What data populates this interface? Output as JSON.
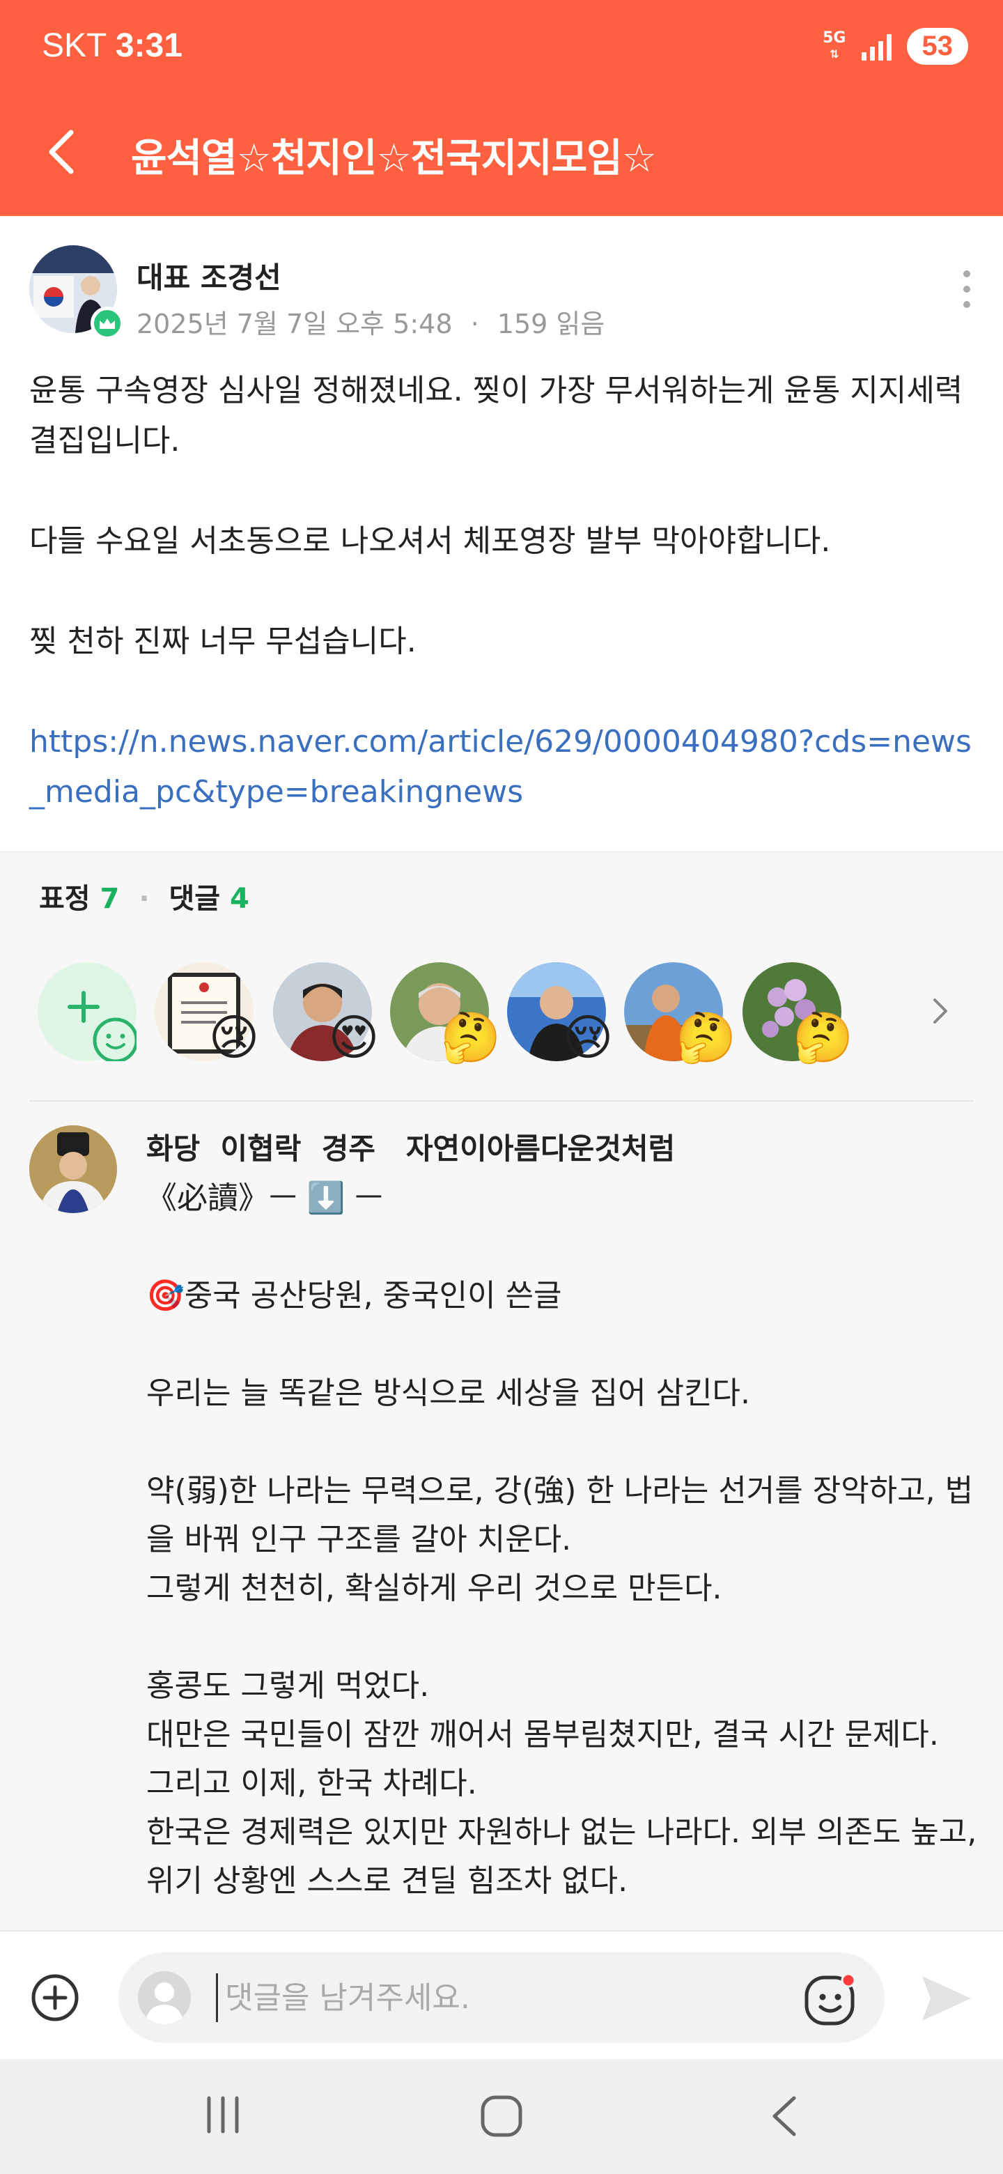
{
  "status_bar": {
    "carrier": "SKT",
    "time": "3:31",
    "network": "5G",
    "battery": "53"
  },
  "header": {
    "title": "윤석열☆천지인☆전국지지모임☆"
  },
  "post": {
    "author": "대표 조경선",
    "date": "2025년 7월 7일 오후 5:48",
    "reads": "159 읽음",
    "paragraphs": [
      "윤통 구속영장 심사일 정해졌네요. 찢이 가장 무서워하는게 윤통 지지세력 결집입니다.",
      "",
      "다들 수요일 서초동으로 나오셔서 체포영장 발부 막아야합니다.",
      "",
      "찢 천하 진짜 너무 무섭습니다.",
      ""
    ],
    "link": "https://n.news.naver.com/article/629/0000404980?cds=news_media_pc&type=breakingnews"
  },
  "reactions": {
    "label_emotion": "표정",
    "emotion_count": "7",
    "label_comment": "댓글",
    "comment_count": "4",
    "emojis": [
      "😢",
      "😍",
      "🤔",
      "😢",
      "🤔",
      "🤔"
    ]
  },
  "comment": {
    "author": "화당  이협락  경주   자연이아름다운것처럼",
    "lines": [
      "《必讀》ㅡ ⬇️ ㅡ",
      "",
      "🎯중국 공산당원, 중국인이 쓴글",
      "",
      "우리는 늘 똑같은 방식으로 세상을 집어 삼킨다.",
      "",
      "약(弱)한 나라는 무력으로, 강(強) 한 나라는 선거를 장악하고, 법을 바꿔 인구 구조를 갈아 치운다.",
      "그렇게 천천히, 확실하게 우리 것으로 만든다.",
      "",
      "홍콩도 그렇게 먹었다.",
      "대만은 국민들이 잠깐 깨어서 몸부림쳤지만, 결국 시간 문제다.",
      "그리고 이제, 한국 차례다.",
      "한국은 경제력은 있지만 자원하나 없는 나라다. 외부 의존도 높고, 위기 상황엔 스스로 견딜 힘조차 없다."
    ]
  },
  "input": {
    "placeholder": "댓글을 남겨주세요."
  },
  "colors": {
    "brand": "#ff6140",
    "count_green": "#19b35f",
    "link_blue": "#3a6fbf"
  }
}
